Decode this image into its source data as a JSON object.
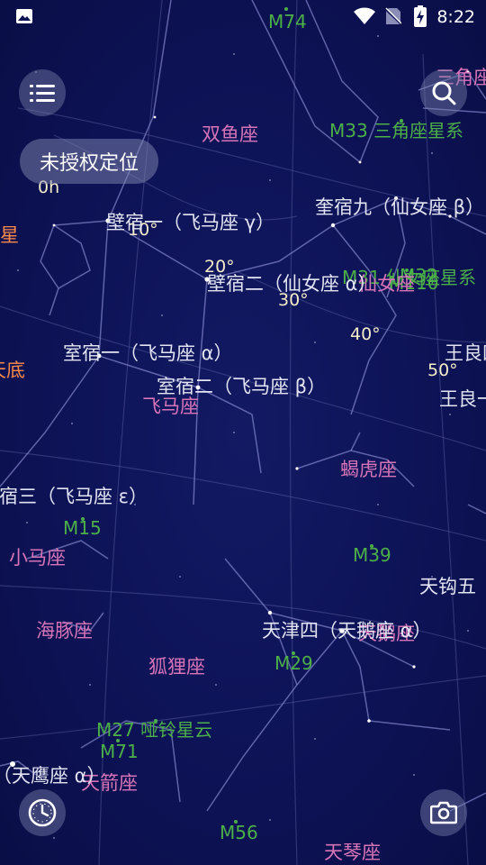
{
  "status_bar": {
    "time": "8:22",
    "icons": [
      "image-icon",
      "wifi-icon",
      "no-sim-icon",
      "battery-charging-icon"
    ]
  },
  "toolbar": {
    "menu_icon": "menu-icon",
    "search_icon": "search-icon",
    "time_icon": "clock-icon",
    "camera_icon": "camera-icon",
    "location_chip": "未授权定位"
  },
  "sky": {
    "hour_label": "0h",
    "degrees": [
      "10°",
      "20°",
      "30°",
      "40°",
      "50°"
    ],
    "stars": [
      "壁宿一（飞马座 γ）",
      "奎宿九（仙女座 β）",
      "壁宿二（仙女座 α）",
      "室宿一（飞马座 α）",
      "室宿二（飞马座 β）",
      "危宿三（飞马座 ε）",
      "王良四",
      "王良一",
      "天钩五",
      "天津四（天鹅座 α）",
      "（天鹰座 α）"
    ],
    "constellations": [
      "三角座",
      "双鱼座",
      "仙女座",
      "飞马座",
      "蝎虎座",
      "小马座",
      "海豚座",
      "天鹅座",
      "狐狸座",
      "天箭座",
      "天琴座"
    ],
    "messier": [
      "M74",
      "M33 三角座星系",
      "M31 仙女座星系",
      "M110",
      "M32",
      "M15",
      "M39",
      "M29",
      "M27 哑铃星云",
      "M71",
      "M56"
    ],
    "edge_labels": [
      "星",
      "天底"
    ]
  },
  "colors": {
    "sky_background": "#0d1255",
    "star_label": "#e2e4f2",
    "constellation_label": "#d774b8",
    "messier_label": "#4caf48",
    "degree_label": "#f3ecc8",
    "edge_label": "#ff8a4a"
  }
}
